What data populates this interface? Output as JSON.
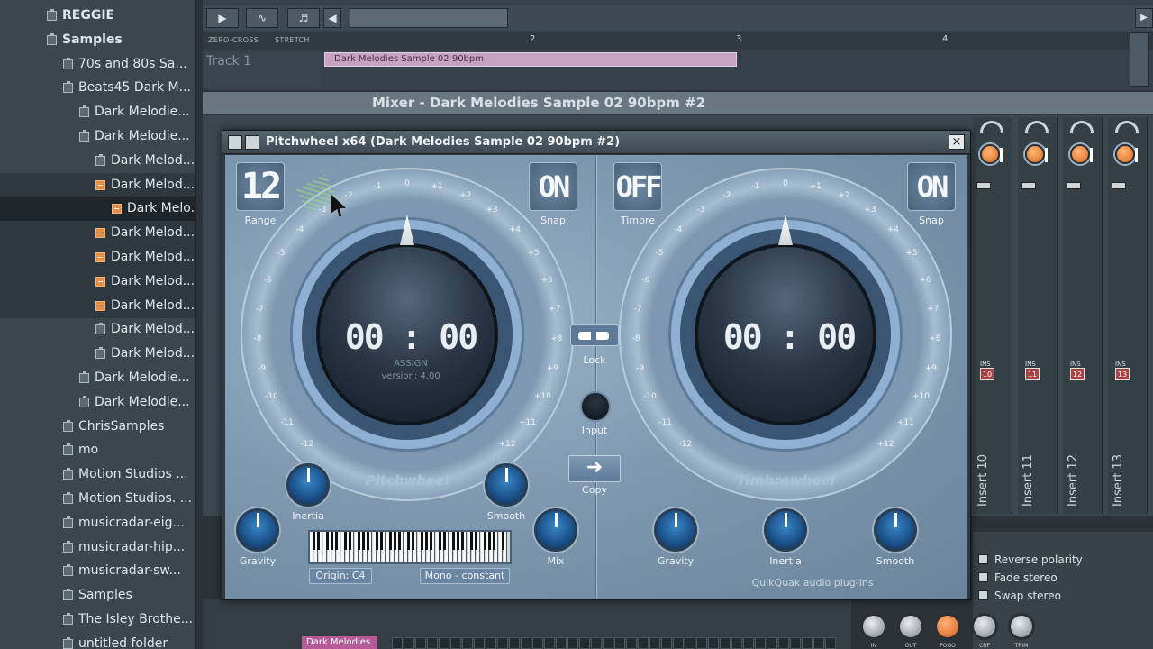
{
  "browser": {
    "items": [
      {
        "label": "REGGIE",
        "kind": "folder",
        "indent": 0
      },
      {
        "label": "Samples",
        "kind": "folder",
        "indent": 0
      },
      {
        "label": "70s and 80s Sa...",
        "kind": "folder",
        "indent": 1
      },
      {
        "label": "Beats45 Dark M...",
        "kind": "folder",
        "indent": 1
      },
      {
        "label": "Dark Melodie...",
        "kind": "folder",
        "indent": 2
      },
      {
        "label": "Dark Melodie...",
        "kind": "folder",
        "indent": 2
      },
      {
        "label": "Dark Melod...",
        "kind": "folder",
        "indent": 3
      },
      {
        "label": "Dark Melod...",
        "kind": "sample",
        "indent": 3
      },
      {
        "label": "Dark Melo...",
        "kind": "sample",
        "indent": 4
      },
      {
        "label": "Dark Melod...",
        "kind": "sample",
        "indent": 3
      },
      {
        "label": "Dark Melod...",
        "kind": "sample",
        "indent": 3
      },
      {
        "label": "Dark Melod...",
        "kind": "sample",
        "indent": 3
      },
      {
        "label": "Dark Melod...",
        "kind": "sample",
        "indent": 3
      },
      {
        "label": "Dark Melod...",
        "kind": "folder",
        "indent": 3
      },
      {
        "label": "Dark Melod...",
        "kind": "folder",
        "indent": 3
      },
      {
        "label": "Dark Melodie...",
        "kind": "folder",
        "indent": 2
      },
      {
        "label": "Dark Melodie...",
        "kind": "folder",
        "indent": 2
      },
      {
        "label": "ChrisSamples",
        "kind": "folder",
        "indent": 1
      },
      {
        "label": "mo",
        "kind": "folder",
        "indent": 1
      },
      {
        "label": "Motion Studios ...",
        "kind": "folder",
        "indent": 1
      },
      {
        "label": "Motion Studios. ...",
        "kind": "folder",
        "indent": 1
      },
      {
        "label": "musicradar-eig...",
        "kind": "folder",
        "indent": 1
      },
      {
        "label": "musicradar-hip...",
        "kind": "folder",
        "indent": 1
      },
      {
        "label": "musicradar-sw...",
        "kind": "folder",
        "indent": 1
      },
      {
        "label": "Samples",
        "kind": "folder",
        "indent": 1
      },
      {
        "label": "The Isley Brothe...",
        "kind": "folder",
        "indent": 1
      },
      {
        "label": "untitled folder",
        "kind": "folder",
        "indent": 1
      }
    ]
  },
  "playlist": {
    "ruler_options": [
      "ZERO-CROSS",
      "STRETCH"
    ],
    "ruler_numbers": [
      "2",
      "3",
      "4"
    ],
    "track_label": "Track 1",
    "clip_label": "Dark Melodies Sample 02 90bpm"
  },
  "mixer": {
    "title": "Mixer - Dark Melodies Sample 02 90bpm #2",
    "strips": [
      {
        "name": "Insert 10",
        "ins": "10"
      },
      {
        "name": "Insert 11",
        "ins": "11"
      },
      {
        "name": "Insert 12",
        "ins": "12"
      },
      {
        "name": "Insert 13",
        "ins": "13"
      }
    ],
    "ins_label": "INS",
    "options": [
      "Reverse polarity",
      "Fade stereo",
      "Swap stereo"
    ],
    "knobs": [
      "IN",
      "OUT",
      "POGO",
      "CRF",
      "TRIM"
    ],
    "bottom_clip": "Dark Melodies"
  },
  "plugin": {
    "title": "Pitchwheel x64 (Dark Melodies Sample 02 90bpm #2)",
    "left": {
      "range_value": "12",
      "range_label": "Range",
      "snap_value": "ON",
      "snap_label": "Snap",
      "time": "00 : 00",
      "assign": "ASSIGN",
      "version": "version: 4.00",
      "name": "Pitchwheel",
      "knobs": [
        "Inertia",
        "Smooth",
        "Gravity",
        "Mix"
      ],
      "origin": "Origin:  C4",
      "mode": "Mono - constant"
    },
    "right": {
      "timbre_value": "OFF",
      "timbre_label": "Timbre",
      "snap_value": "ON",
      "snap_label": "Snap",
      "time": "00 : 00",
      "name": "Timbrewheel",
      "knobs": [
        "Gravity",
        "Inertia",
        "Smooth"
      ]
    },
    "center": {
      "lock": "Lock",
      "input": "Input",
      "copy": "Copy"
    },
    "ticks": [
      "0",
      "-1",
      "+1",
      "-2",
      "+2",
      "-3",
      "+3",
      "-4",
      "+4",
      "-5",
      "+5",
      "-6",
      "+6",
      "-7",
      "+7",
      "-8",
      "+8",
      "-9",
      "+9",
      "-10",
      "+10",
      "-11",
      "+11",
      "-12",
      "+12"
    ],
    "brand": "QuikQuak audio plug-ins"
  }
}
